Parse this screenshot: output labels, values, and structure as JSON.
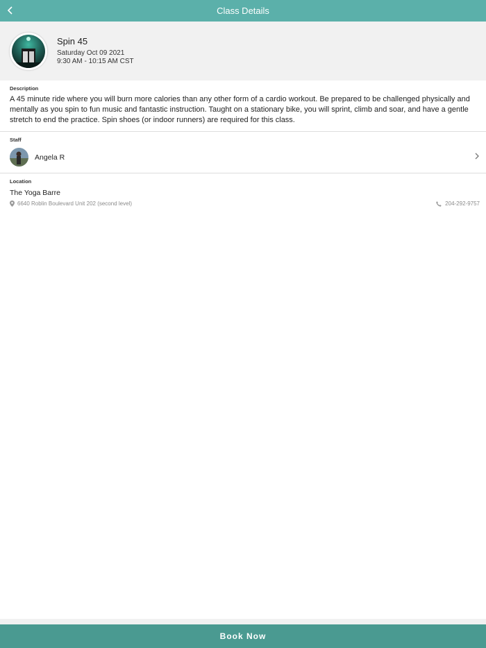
{
  "navbar": {
    "title": "Class Details",
    "back_icon": "chevron-left-icon"
  },
  "class": {
    "name": "Spin 45",
    "date": "Saturday Oct 09 2021",
    "time": "9:30 AM - 10:15 AM CST"
  },
  "description": {
    "label": "Description",
    "text": "A 45 minute ride where you will burn more calories than any other form of a cardio workout. Be prepared to be challenged physically and mentally as you spin to fun music and fantastic instruction. Taught on a stationary bike, you will sprint, climb and soar, and have a gentle stretch to end the practice. Spin shoes (or indoor runners) are required for this class."
  },
  "staff": {
    "label": "Staff",
    "name": "Angela R",
    "chevron_icon": "chevron-right-icon"
  },
  "location": {
    "label": "Location",
    "name": "The Yoga Barre",
    "address": "6640 Roblin Boulevard Unit 202 (second level)",
    "phone": "204-292-9757",
    "address_icon": "map-pin-icon",
    "phone_icon": "phone-icon"
  },
  "book_button": {
    "label": "Book Now"
  },
  "colors": {
    "navbar": "#5bb0aa",
    "button": "#4a9a91",
    "header_bg": "#f1f1f1"
  }
}
